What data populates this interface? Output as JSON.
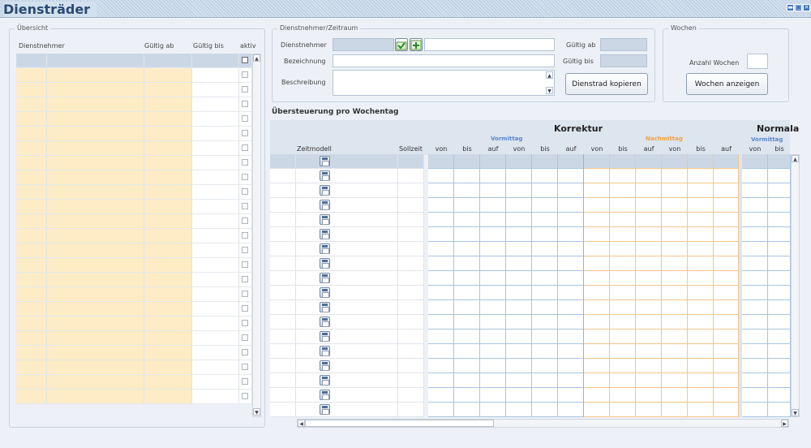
{
  "window": {
    "title": "Diensträder"
  },
  "uebersicht": {
    "legend": "Übersicht",
    "cols": [
      "Dienstnehmer",
      "Gültig ab",
      "Gültig bis",
      "aktiv"
    ],
    "row_count": 24
  },
  "dn": {
    "legend": "Dienstnehmer/Zeitraum",
    "dienstnehmer_label": "Dienstnehmer",
    "bezeichnung_label": "Bezeichnung",
    "beschreibung_label": "Beschreibung",
    "gueltig_ab_label": "Gültig ab",
    "gueltig_bis_label": "Gültig bis",
    "kopieren_label": "Dienstrad kopieren"
  },
  "wochen": {
    "legend": "Wochen",
    "anzahl_label": "Anzahl Wochen",
    "anzeigen_label": "Wochen anzeigen"
  },
  "grid": {
    "section_title": "Übersteuerung pro Wochentag",
    "korrektur": "Korrektur",
    "normal": "Normala",
    "vormittag": "Vormittag",
    "nachmittag": "Nachmittag",
    "zeitmodell": "Zeitmodell",
    "sollzeit": "Sollzeit",
    "von": "von",
    "bis": "bis",
    "auf": "auf",
    "row_count": 18
  },
  "colors": {
    "vormittag": "#5b86c9",
    "nachmittag": "#f0a040",
    "yellow": "#fdecc5"
  }
}
